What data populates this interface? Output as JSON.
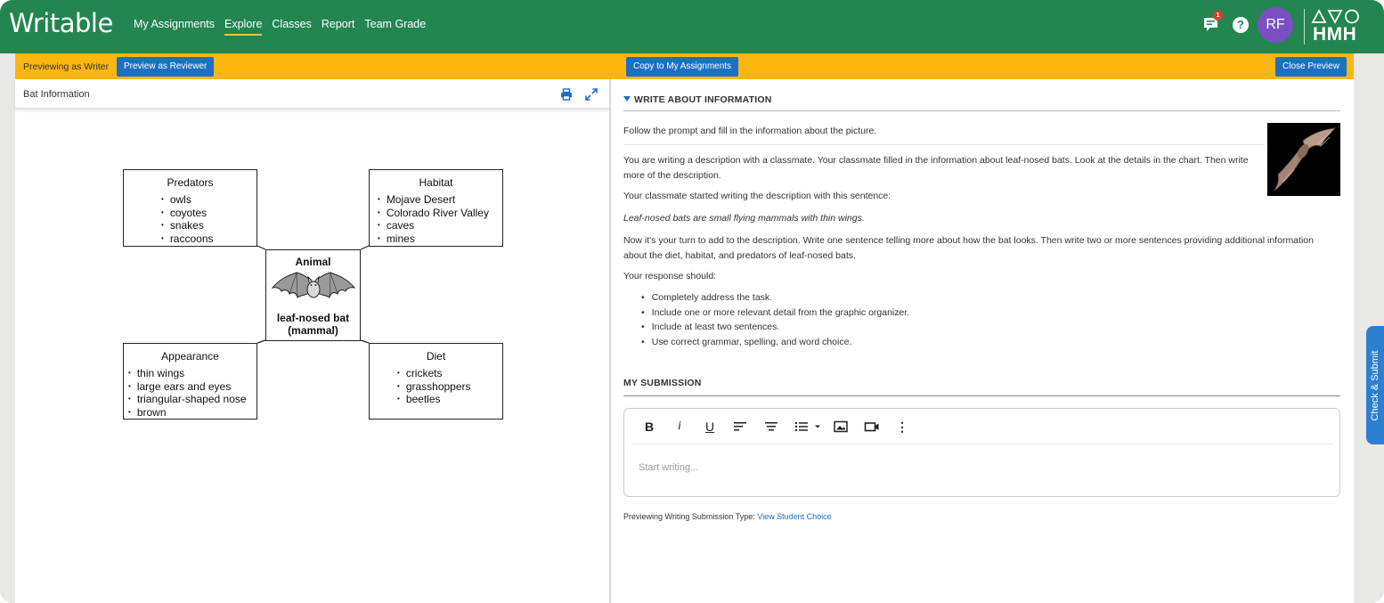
{
  "app": {
    "logo": "Writable",
    "nav": [
      "My Assignments",
      "Explore",
      "Classes",
      "Report",
      "Team Grade"
    ],
    "active_nav": "Explore",
    "notification_count": "1",
    "help_symbol": "?",
    "avatar_initials": "RF",
    "brand": "HMH",
    "colors": {
      "topbar": "#23854f",
      "preview_bar": "#fbb610",
      "button": "#1d6fc4",
      "avatar": "#7b4fc4"
    }
  },
  "preview_bar": {
    "label": "Previewing as Writer",
    "preview_reviewer": "Preview as Reviewer",
    "copy": "Copy to My Assignments",
    "close": "Close Preview"
  },
  "left_pane": {
    "title": "Bat Information",
    "organizer": {
      "predators": {
        "title": "Predators",
        "items": [
          "owls",
          "coyotes",
          "snakes",
          "raccoons"
        ]
      },
      "habitat": {
        "title": "Habitat",
        "items": [
          "Mojave Desert",
          "Colorado River Valley",
          "caves",
          "mines"
        ]
      },
      "center": {
        "title": "Animal",
        "name": "leaf-nosed bat",
        "sub": "(mammal)"
      },
      "appearance": {
        "title": "Appearance",
        "items": [
          "thin wings",
          "large ears and eyes",
          "triangular-shaped nose",
          "brown"
        ]
      },
      "diet": {
        "title": "Diet",
        "items": [
          "crickets",
          "grasshoppers",
          "beetles"
        ]
      }
    }
  },
  "right_pane": {
    "section_title": "WRITE ABOUT INFORMATION",
    "intro": "Follow the prompt and fill in the information about the picture.",
    "para1": "You are writing a description with a classmate. Your classmate filled in the information about leaf-nosed bats. Look at the details in the chart. Then write more of the description.",
    "para2": "Your classmate started writing the description with this sentence:",
    "quote": "Leaf-nosed bats are small flying mammals with thin wings.",
    "para3": "Now it's your turn to add to the description. Write one sentence telling more about how the bat looks. Then write two or more sentences providing additional information about the diet, habitat, and predators of leaf-nosed bats.",
    "para4": "Your response should:",
    "bullets": [
      "Completely address the task.",
      "Include one or more relevant detail from the graphic organizer.",
      "Include at least two sentences.",
      "Use correct grammar, spelling, and word choice."
    ],
    "submission_title": "MY SUBMISSION",
    "editor": {
      "placeholder": "Start writing...",
      "tools": {
        "bold": "B",
        "italic": "i",
        "underline": "U",
        "more": "⋮"
      }
    },
    "footer_prefix": "Previewing Writing Submission Type:",
    "footer_link": "View Student Choice"
  },
  "side_tab": "Check & Submit"
}
